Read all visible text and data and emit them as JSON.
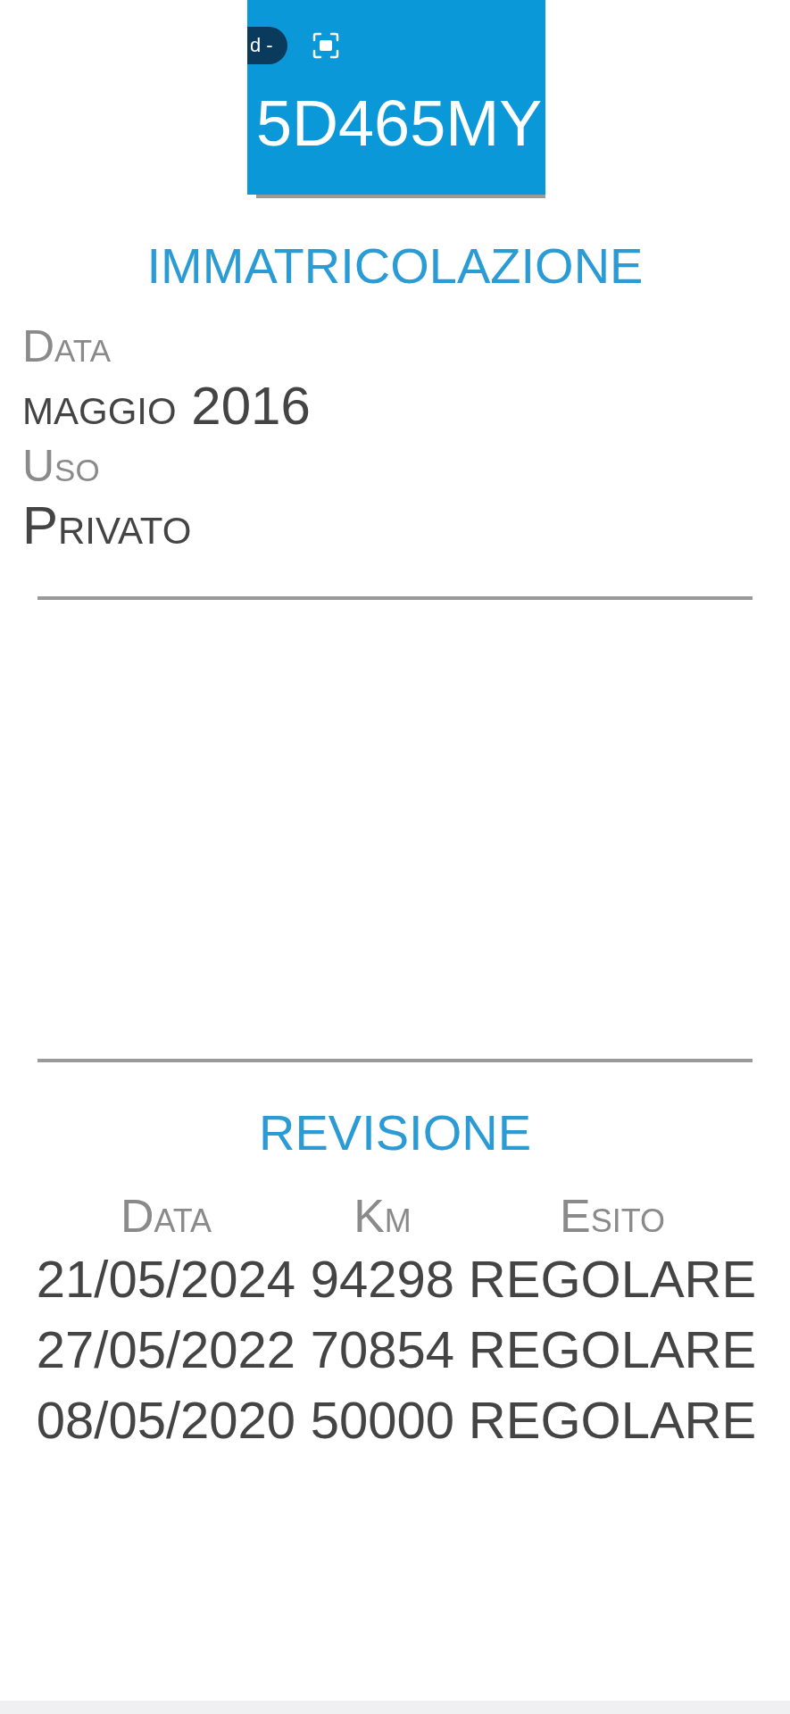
{
  "overlay": {
    "pill": "d -",
    "plate": "5D465MY"
  },
  "registration": {
    "title": "IMMATRICOLAZIONE",
    "fields": [
      {
        "label": "Data",
        "value": "maggio 2016"
      },
      {
        "label": "Uso",
        "value": "Privato"
      }
    ]
  },
  "inspection": {
    "title": "REVISIONE",
    "columns": [
      "Data",
      "Km",
      "Esito"
    ],
    "rows": [
      [
        "21/05/2024",
        "94298",
        "REGOLARE"
      ],
      [
        "27/05/2022",
        "70854",
        "REGOLARE"
      ],
      [
        "08/05/2020",
        "50000",
        "REGOLARE"
      ]
    ]
  }
}
